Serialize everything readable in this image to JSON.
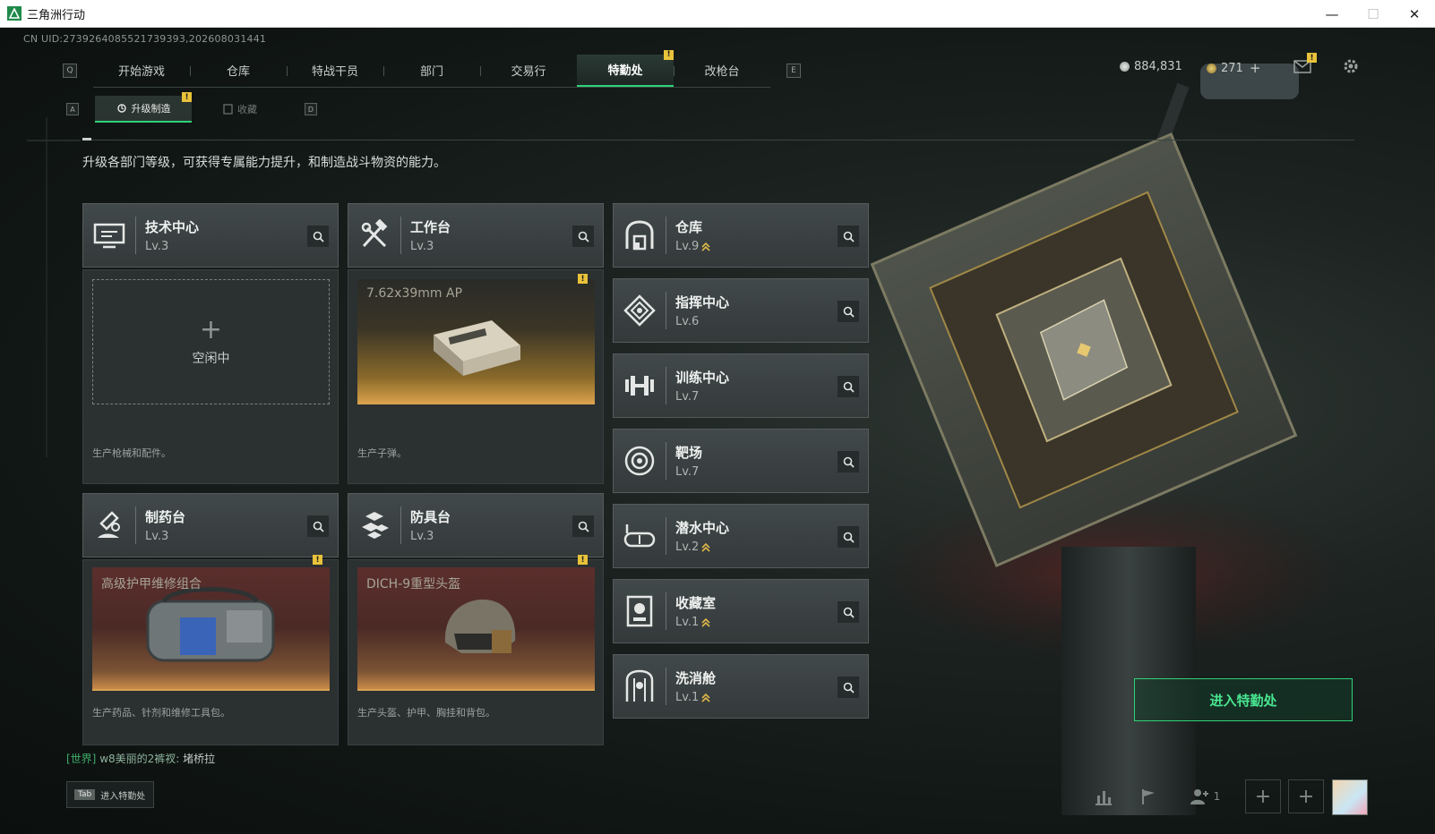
{
  "window": {
    "title": "三角洲行动",
    "minimize": "—",
    "maximize": "☐",
    "close": "✕"
  },
  "uid": "CN UID:2739264085521739393,202608031441",
  "nav": {
    "prev_key": "Q",
    "next_key": "E",
    "tabs": [
      {
        "label": "开始游戏"
      },
      {
        "label": "仓库"
      },
      {
        "label": "特战干员"
      },
      {
        "label": "部门"
      },
      {
        "label": "交易行"
      },
      {
        "label": "特勤处",
        "active": true,
        "badge": "!"
      },
      {
        "label": "改枪台"
      }
    ]
  },
  "currency": {
    "silver": "884,831",
    "gold": "271",
    "add": "+"
  },
  "mail_badge": "!",
  "subnav": {
    "prev_key": "A",
    "next_key": "D",
    "tabs": [
      {
        "label": "升级制造",
        "active": true,
        "badge": "!"
      },
      {
        "label": "收藏"
      }
    ]
  },
  "description": "升级各部门等级，可获得专属能力提升，和制造战斗物资的能力。",
  "facilities": {
    "tech": {
      "name": "技术中心",
      "level": "Lv.3",
      "status": "空闲中",
      "plus": "+",
      "note": "生产枪械和配件。"
    },
    "workbench": {
      "name": "工作台",
      "level": "Lv.3",
      "product": "7.62x39mm AP",
      "badge": "!",
      "note": "生产子弹。"
    },
    "pharmacy": {
      "name": "制药台",
      "level": "Lv.3",
      "product": "高级护甲维修组合",
      "badge": "!",
      "note": "生产药品、针剂和维修工具包。"
    },
    "armor": {
      "name": "防具台",
      "level": "Lv.3",
      "product": "DICH-9重型头盔",
      "badge": "!",
      "note": "生产头盔、护甲、胸挂和背包。"
    }
  },
  "side_facilities": [
    {
      "name": "仓库",
      "level": "Lv.9",
      "upgradable": true
    },
    {
      "name": "指挥中心",
      "level": "Lv.6",
      "upgradable": false
    },
    {
      "name": "训练中心",
      "level": "Lv.7",
      "upgradable": false
    },
    {
      "name": "靶场",
      "level": "Lv.7",
      "upgradable": false
    },
    {
      "name": "潜水中心",
      "level": "Lv.2",
      "upgradable": true
    },
    {
      "name": "收藏室",
      "level": "Lv.1",
      "upgradable": true
    },
    {
      "name": "洗消舱",
      "level": "Lv.1",
      "upgradable": true
    }
  ],
  "enter_button": "进入特勤处",
  "chat": {
    "channel": "[世界]",
    "user": "w8美丽的2裤衩:",
    "message": "堵桥拉"
  },
  "tab_hint": {
    "key": "Tab",
    "label": "进入特勤处"
  },
  "bottom_bar": {
    "squad_count": "1",
    "slot_plus": "+"
  },
  "colors": {
    "accent": "#2fd27a",
    "badge": "#e8c23a",
    "upgrade": "#e0b84a"
  },
  "icons": [
    "search-icon",
    "settings-icon",
    "mail-icon",
    "stats-icon",
    "flag-icon",
    "squad-icon",
    "upgrade-arrow-icon"
  ]
}
